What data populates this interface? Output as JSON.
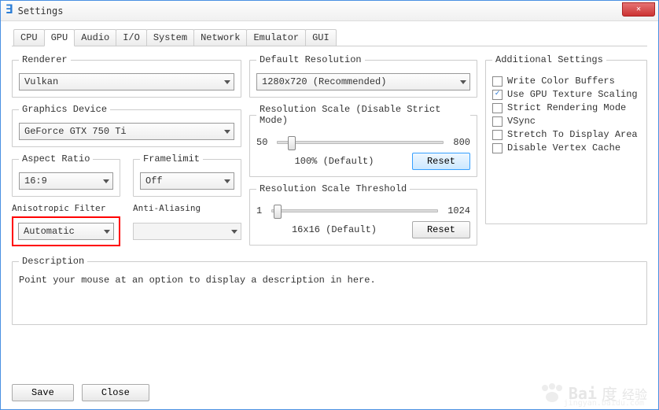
{
  "window": {
    "title": "Settings"
  },
  "tabs": [
    "CPU",
    "GPU",
    "Audio",
    "I/O",
    "System",
    "Network",
    "Emulator",
    "GUI"
  ],
  "active_tab": 1,
  "left": {
    "renderer": {
      "label": "Renderer",
      "value": "Vulkan"
    },
    "graphics_device": {
      "label": "Graphics Device",
      "value": "GeForce GTX 750 Ti"
    },
    "aspect_ratio": {
      "label": "Aspect Ratio",
      "value": "16:9"
    },
    "framelimit": {
      "label": "Framelimit",
      "value": "Off"
    },
    "aniso": {
      "label": "Anisotropic Filter",
      "value": "Automatic"
    },
    "aa": {
      "label": "Anti-Aliasing",
      "value": ""
    }
  },
  "mid": {
    "default_res": {
      "label": "Default Resolution",
      "value": "1280x720 (Recommended)"
    },
    "res_scale": {
      "label": "Resolution Scale (Disable Strict Mode)",
      "min": "50",
      "max": "800",
      "value_label": "100% (Default)",
      "reset": "Reset"
    },
    "res_thresh": {
      "label": "Resolution Scale Threshold",
      "min": "1",
      "max": "1024",
      "value_label": "16x16 (Default)",
      "reset": "Reset"
    }
  },
  "right": {
    "label": "Additional Settings",
    "items": [
      {
        "key": "write_color_buffers",
        "label": "Write Color Buffers",
        "checked": false
      },
      {
        "key": "gpu_texture_scaling",
        "label": "Use GPU Texture Scaling",
        "checked": true
      },
      {
        "key": "strict_rendering",
        "label": "Strict Rendering Mode",
        "checked": false
      },
      {
        "key": "vsync",
        "label": "VSync",
        "checked": false
      },
      {
        "key": "stretch_display",
        "label": "Stretch To Display Area",
        "checked": false
      },
      {
        "key": "disable_vertex_cache",
        "label": "Disable Vertex Cache",
        "checked": false
      }
    ]
  },
  "description": {
    "label": "Description",
    "text": "Point your mouse at an option to display a description in here."
  },
  "buttons": {
    "save": "Save",
    "close": "Close"
  },
  "watermark": {
    "main": "Bai",
    "accent": "度",
    "suffix": "经验",
    "sub": "jingyan.baidu.com"
  }
}
